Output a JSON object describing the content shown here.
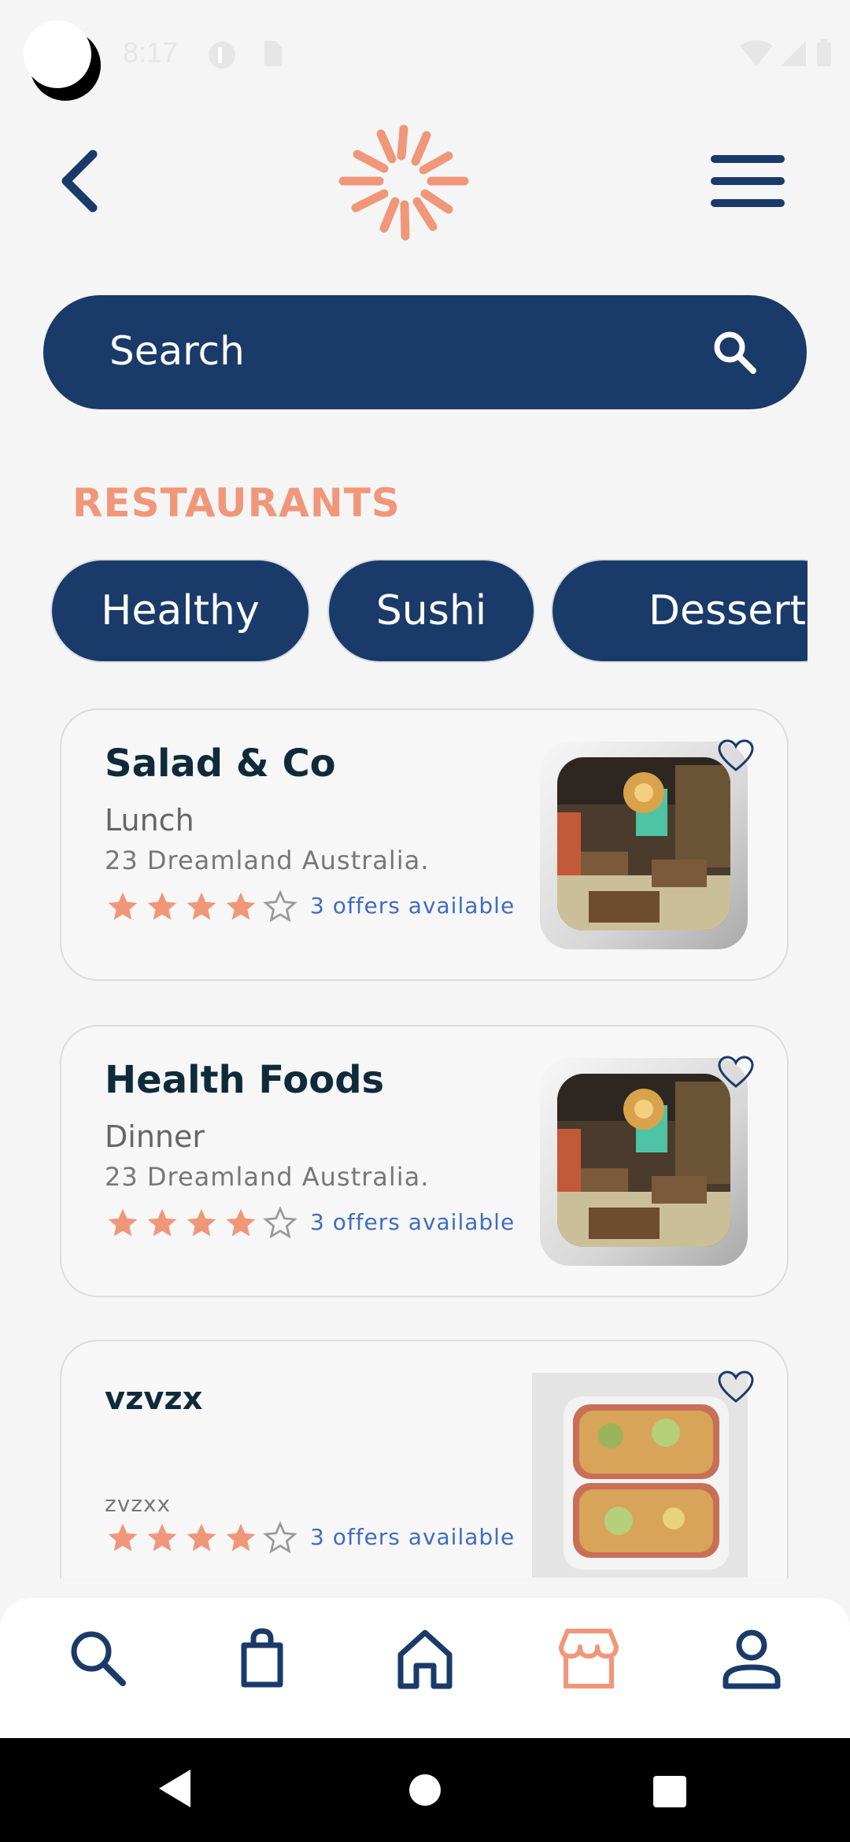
{
  "status_bar": {
    "time": "8:17"
  },
  "search": {
    "placeholder": "Search"
  },
  "section": {
    "title": "RESTAURANTS"
  },
  "categories": [
    "Healthy",
    "Sushi",
    "Desserts"
  ],
  "restaurants": [
    {
      "name": "Salad & Co",
      "category": "Lunch",
      "address": "23 Dreamland Australia.",
      "rating": 4,
      "offers": "3 offers available",
      "image": "restaurant-interior"
    },
    {
      "name": "Health Foods",
      "category": "Dinner",
      "address": "23 Dreamland Australia.",
      "rating": 4,
      "offers": "3 offers available",
      "image": "restaurant-interior"
    },
    {
      "name": "vzvzx",
      "category": "",
      "address": "zvzxx",
      "rating": 4,
      "offers": "3 offers available",
      "image": "meal-prep-bowls"
    }
  ],
  "bottom_nav": [
    "search-icon",
    "bag-icon",
    "home-icon",
    "store-icon",
    "profile-icon"
  ],
  "colors": {
    "primary": "#1a3a69",
    "accent": "#f0977a",
    "link": "#3f6dbf"
  }
}
